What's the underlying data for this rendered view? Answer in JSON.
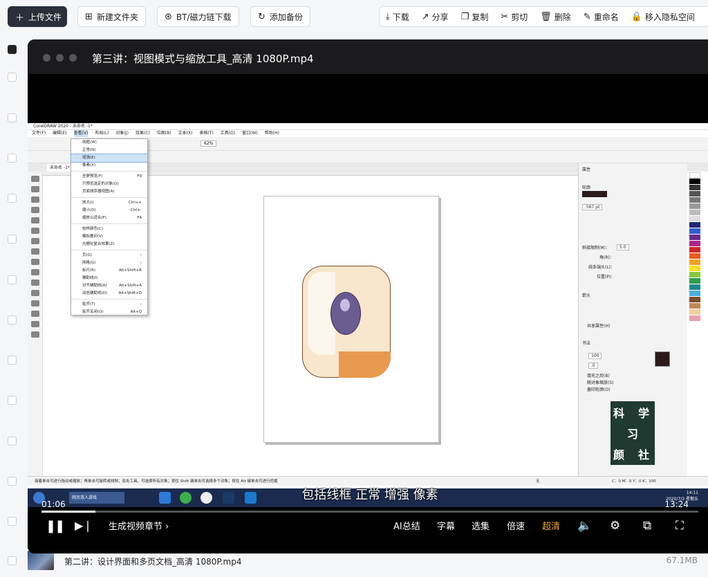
{
  "toolbar": {
    "upload": "上传文件",
    "new_folder": "新建文件夹",
    "bt_download": "BT/磁力链下载",
    "add_backup": "添加备份",
    "actions": [
      "下载",
      "分享",
      "复制",
      "剪切",
      "删除",
      "重命名",
      "移入隐私空间"
    ]
  },
  "icons": {
    "upload": "plus-icon",
    "new_folder": "folder-plus-icon",
    "bt": "magnet-icon",
    "backup": "refresh-icon"
  },
  "player": {
    "title": "第三讲：视图模式与缩放工具_高清 1080P.mp4",
    "subtitle": "包括线框 正常 增强 像素",
    "time_current": "01:06",
    "time_total": "13:24",
    "progress": 0.082,
    "chapters_button": "生成视频章节 ›",
    "controls": {
      "ai_summary": "AI总结",
      "captions": "字幕",
      "episodes": "选集",
      "speed": "倍速",
      "quality": "超清"
    }
  },
  "coreldraw": {
    "title": "CorelDRAW 2020 - 未命名 -1*",
    "menus": [
      "文件(F)",
      "编辑(E)",
      "查看(V)",
      "布局(L)",
      "对象(J)",
      "效果(C)",
      "位图(B)",
      "文本(X)",
      "表格(T)",
      "工具(O)",
      "窗口(W)",
      "帮助(H)"
    ],
    "tab": "未命名 -1*",
    "zoom": "62%",
    "view_menu": [
      {
        "label": "线框(W)",
        "shortcut": ""
      },
      {
        "label": "正常(N)",
        "shortcut": ""
      },
      {
        "label": "增强(E)",
        "shortcut": "",
        "selected": true
      },
      {
        "label": "像素(X)",
        "shortcut": ""
      },
      {
        "sep": true
      },
      {
        "label": "全屏预览(F)",
        "shortcut": "F9"
      },
      {
        "label": "只预览选定的对象(O)",
        "shortcut": ""
      },
      {
        "label": "页面排序器视图(A)",
        "shortcut": ""
      },
      {
        "sep": true
      },
      {
        "label": "放大(I)",
        "shortcut": "Ctrl++"
      },
      {
        "label": "缩小(O)",
        "shortcut": "Ctrl+-"
      },
      {
        "label": "缩放以适合(F)",
        "shortcut": "F4"
      },
      {
        "sep": true
      },
      {
        "label": "校样颜色(C)",
        "shortcut": ""
      },
      {
        "label": "模拟叠印(V)",
        "shortcut": ""
      },
      {
        "label": "光栅化复合效果(Z)",
        "shortcut": ""
      },
      {
        "sep": true
      },
      {
        "label": "页(G)",
        "shortcut": "›"
      },
      {
        "label": "网格(G)",
        "shortcut": "›"
      },
      {
        "label": "标尺(R)",
        "shortcut": "Alt+Shift+R"
      },
      {
        "label": "辅助线(I)",
        "shortcut": ""
      },
      {
        "label": "对齐辅助线(A)",
        "shortcut": "Alt+Shift+A"
      },
      {
        "label": "动态辅助线(D)",
        "shortcut": "Alt+Shift+D"
      },
      {
        "sep": true
      },
      {
        "label": "贴齐(T)",
        "shortcut": "›"
      },
      {
        "label": "贴齐关闭(O)",
        "shortcut": "Alt+Q"
      }
    ],
    "props": {
      "header": "属性",
      "outline": "轮廓",
      "width": ".567 pt",
      "miter": "斜接限制(M)：",
      "miter_val": "5.0",
      "corner": "角(R)：",
      "line_end": "线条端头(L)：",
      "position": "位置(P)：",
      "arrow": "箭头",
      "share": "共享属性(H)",
      "calligraphy": "书法",
      "stretch": "100",
      "angle": ".0",
      "fill_behind": "填充之后(B)",
      "scale": "随对象缩放(S)",
      "overprint": "叠印轮廓(O)"
    },
    "logo_chars": [
      "科",
      "学",
      "习",
      "颜",
      "社"
    ],
    "status": "接着单击可进行拖动或缩放；再单击可旋转或倾斜；双击工具，可选择所有对象；按住 Shift 键单击可选择多个对象；按住 Alt 键单击可进行挖掘",
    "fill_status": "C：0 M：0 Y：0 K：100",
    "no_fill": "无",
    "page_tab": "页1",
    "taskbar_time": "14:11",
    "taskbar_date": "2020/7/3 星期五",
    "ie_tab": "网页双人游戏"
  },
  "files": [
    {
      "name": "第二讲：设计界面和多页文档_高清 1080P.mp4",
      "size": "67.1MB"
    }
  ],
  "colors": {
    "primary_btn": "#2a2f3a",
    "quality_accent": "#f0a830"
  }
}
